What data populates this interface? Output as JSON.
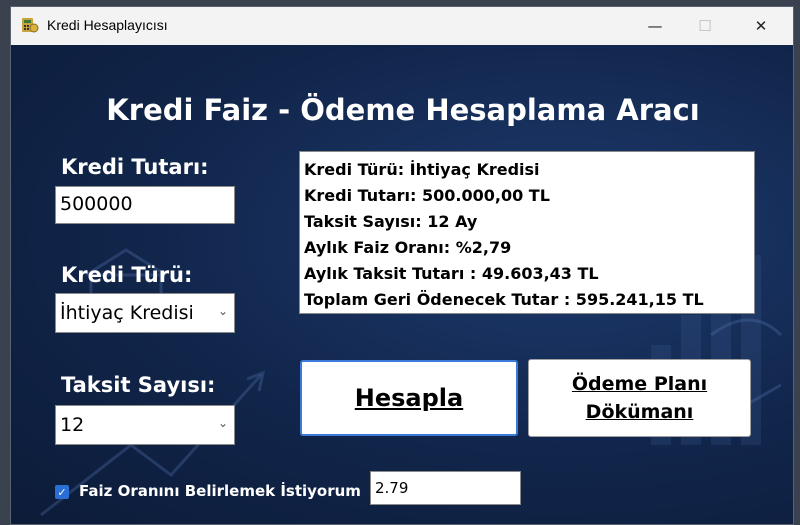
{
  "window": {
    "title": "Kredi Hesaplayıcısı"
  },
  "titlebar_buttons": {
    "minimize": "—",
    "maximize": "☐",
    "close": "✕"
  },
  "heading": "Kredi Faiz - Ödeme Hesaplama Aracı",
  "form": {
    "amount_label": "Kredi Tutarı:",
    "amount_value": "500000",
    "type_label": "Kredi Türü:",
    "type_value": "İhtiyaç Kredisi",
    "installment_label": "Taksit Sayısı:",
    "installment_value": "12"
  },
  "result": {
    "lines": [
      "Kredi Türü: İhtiyaç Kredisi",
      "Kredi Tutarı: 500.000,00 TL",
      "Taksit Sayısı: 12 Ay",
      "Aylık Faiz Oranı: %2,79",
      "Aylık Taksit Tutarı : 49.603,43 TL",
      "Toplam Geri Ödenecek Tutar : 595.241,15 TL"
    ]
  },
  "buttons": {
    "calculate": "Hesapla",
    "plan_line1": "Ödeme Planı",
    "plan_line2": "Dökümanı"
  },
  "rate_option": {
    "checked": true,
    "label": "Faiz Oranını Belirlemek İstiyorum",
    "value": "2.79"
  },
  "colors": {
    "background": "#13264a",
    "accent": "#2a6fd6",
    "text_light": "#ffffff"
  }
}
